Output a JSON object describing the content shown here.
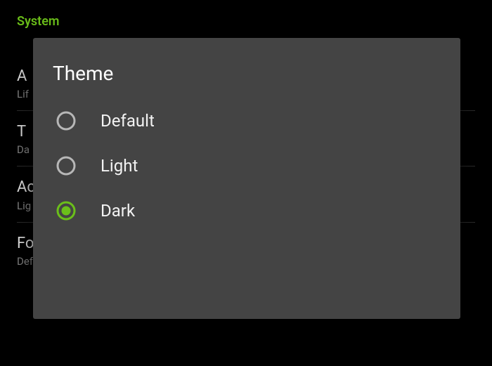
{
  "section_header": "System",
  "settings": {
    "row1_title": "A",
    "row1_sub": "Lif",
    "row2_title": "T",
    "row2_sub": "Da",
    "row3_title": "Ac",
    "row3_sub": "Lig",
    "row4_title": "Font size",
    "row4_sub": "Default"
  },
  "modal": {
    "title": "Theme",
    "options": {
      "opt1": "Default",
      "opt2": "Light",
      "opt3": "Dark"
    },
    "selected": "Dark"
  },
  "colors": {
    "accent": "#6bbf1a",
    "modal_bg": "#444444",
    "unselected_ring": "#b7b7b7"
  }
}
